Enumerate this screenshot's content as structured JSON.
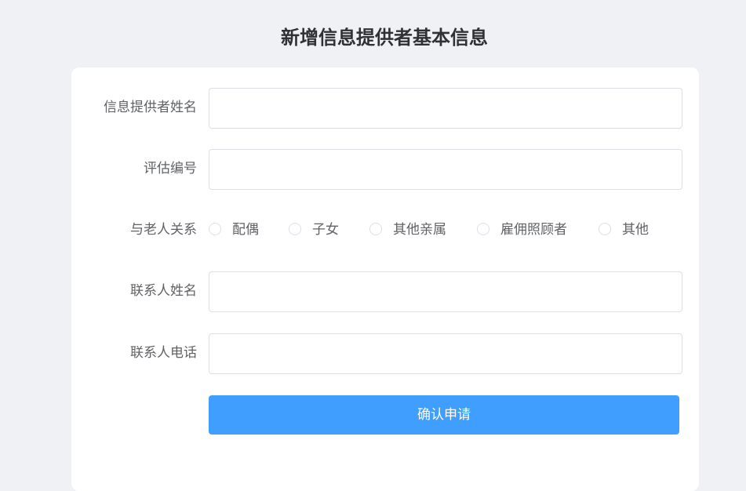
{
  "page": {
    "title": "新增信息提供者基本信息"
  },
  "form": {
    "provider_name": {
      "label": "信息提供者姓名",
      "value": "",
      "placeholder": ""
    },
    "assessment_no": {
      "label": "评估编号",
      "value": "",
      "placeholder": ""
    },
    "relationship": {
      "label": "与老人关系",
      "options": [
        "配偶",
        "子女",
        "其他亲属",
        "雇佣照顾者",
        "其他"
      ],
      "selected": null
    },
    "contact_name": {
      "label": "联系人姓名",
      "value": "",
      "placeholder": ""
    },
    "contact_phone": {
      "label": "联系人电话",
      "value": "",
      "placeholder": ""
    },
    "submit_label": "确认申请"
  },
  "colors": {
    "primary": "#409eff",
    "background": "#f0f1f5",
    "border": "#dcdfe6"
  }
}
